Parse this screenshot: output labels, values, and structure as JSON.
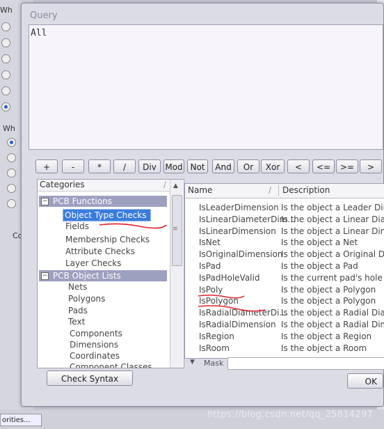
{
  "background": {
    "left_labels": [
      "Wh",
      "Wh",
      "Co"
    ],
    "bottom_button": "orities..."
  },
  "dialog": {
    "query_label": "Query",
    "query_text": "All",
    "operators": [
      "+",
      "-",
      "*",
      "/",
      "Div",
      "Mod",
      "Not",
      "And",
      "Or",
      "Xor",
      "<",
      "<=",
      ">=",
      ">"
    ],
    "categories": {
      "header": "Categories",
      "groups": [
        {
          "label": "PCB Functions",
          "items": [
            "Object Type Checks",
            "Fields",
            "Membership Checks",
            "Attribute Checks",
            "Layer Checks"
          ]
        },
        {
          "label": "PCB Object Lists",
          "items": [
            "Nets",
            "Polygons",
            "Pads",
            "Text",
            "Components",
            "Dimensions",
            "Coordinates",
            "Component Classes"
          ]
        }
      ],
      "selected": "Object Type Checks"
    },
    "list": {
      "col_name": "Name",
      "col_desc": "Description",
      "rows": [
        {
          "name": "IsLeaderDimension",
          "desc": "Is the object a Leader Dimen"
        },
        {
          "name": "IsLinearDiameterDim...",
          "desc": "Is the object a Linear Diame"
        },
        {
          "name": "IsLinearDimension",
          "desc": "Is the object a Linear Dimens"
        },
        {
          "name": "IsNet",
          "desc": "Is the object a Net"
        },
        {
          "name": "IsOriginalDimension",
          "desc": "Is the object a Original Dimen"
        },
        {
          "name": "IsPad",
          "desc": "Is the object a Pad"
        },
        {
          "name": "IsPadHoleValid",
          "desc": "Is the current pad's hole size"
        },
        {
          "name": "IsPoly",
          "desc": "Is the object a Polygon"
        },
        {
          "name": "IsPolygon",
          "desc": "Is the object a Polygon"
        },
        {
          "name": "IsRadialDiameterDi...",
          "desc": "Is the object a Radial Diameter"
        },
        {
          "name": "IsRadialDimension",
          "desc": "Is the object a Radial Dimensio"
        },
        {
          "name": "IsRegion",
          "desc": "Is the object a Region"
        },
        {
          "name": "IsRoom",
          "desc": "Is the object a Room"
        }
      ]
    },
    "mask_label": "Mask",
    "check_syntax": "Check Syntax",
    "ok": "OK"
  },
  "watermark": "https://blog.csdn.net/qq_25814297",
  "colors": {
    "selection": "#3a7bdc",
    "group_header": "#9ea0c0",
    "annotation_ink": "#e0202a"
  }
}
